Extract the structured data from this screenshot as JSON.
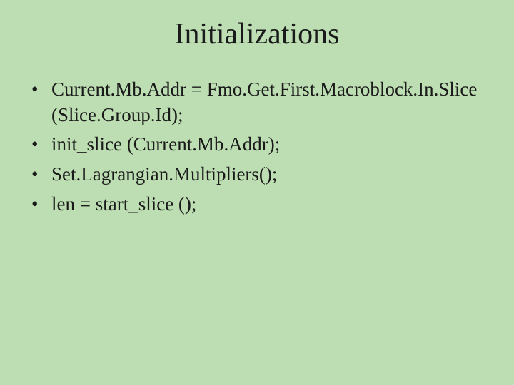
{
  "slide": {
    "title": "Initializations",
    "bullets": [
      "Current.Mb.Addr = Fmo.Get.First.Macroblock.In.Slice (Slice.Group.Id);",
      "init_slice (Current.Mb.Addr);",
      "Set.Lagrangian.Multipliers();",
      "len = start_slice ();"
    ]
  }
}
